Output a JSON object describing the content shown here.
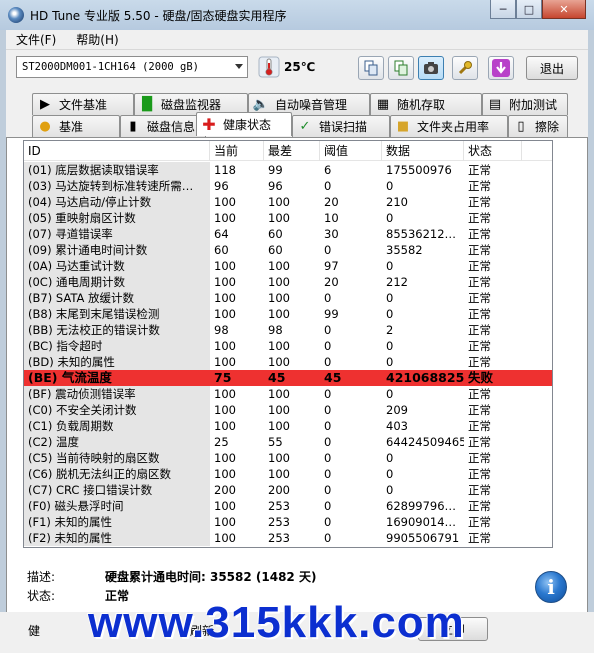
{
  "window": {
    "title": "HD Tune 专业版 5.50 - 硬盘/固态硬盘实用程序"
  },
  "menu": [
    {
      "label": "文件(F)"
    },
    {
      "label": "帮助(H)"
    }
  ],
  "toolbar": {
    "drive": "ST2000DM001-1CH164 (2000 gB)",
    "temperature": "25℃",
    "exit_label": "退出"
  },
  "tabs_row1": [
    {
      "label": "文件基准",
      "icon": "file-benchmark-icon"
    },
    {
      "label": "磁盘监视器",
      "icon": "disk-monitor-icon"
    },
    {
      "label": "自动噪音管理",
      "icon": "speaker-icon"
    },
    {
      "label": "随机存取",
      "icon": "random-access-icon"
    },
    {
      "label": "附加测试",
      "icon": "extra-tests-icon"
    }
  ],
  "tabs_row2": [
    {
      "label": "基准",
      "icon": "benchmark-icon"
    },
    {
      "label": "磁盘信息",
      "icon": "disk-info-icon"
    },
    {
      "label": "健康状态",
      "icon": "health-icon"
    },
    {
      "label": "错误扫描",
      "icon": "error-scan-icon"
    },
    {
      "label": "文件夹占用率",
      "icon": "folder-usage-icon"
    },
    {
      "label": "擦除",
      "icon": "erase-icon"
    }
  ],
  "table": {
    "headers": [
      "ID",
      "当前",
      "最差",
      "阈值",
      "数据",
      "状态"
    ],
    "rows": [
      [
        "(01) 底层数据读取错误率",
        "118",
        "99",
        "6",
        "175500976",
        "正常"
      ],
      [
        "(03) 马达旋转到标准转速所需…",
        "96",
        "96",
        "0",
        "0",
        "正常"
      ],
      [
        "(04) 马达启动/停止计数",
        "100",
        "100",
        "20",
        "210",
        "正常"
      ],
      [
        "(05) 重映射扇区计数",
        "100",
        "100",
        "10",
        "0",
        "正常"
      ],
      [
        "(07) 寻道错误率",
        "64",
        "60",
        "30",
        "85536212…",
        "正常"
      ],
      [
        "(09) 累计通电时间计数",
        "60",
        "60",
        "0",
        "35582",
        "正常"
      ],
      [
        "(0A) 马达重试计数",
        "100",
        "100",
        "97",
        "0",
        "正常"
      ],
      [
        "(0C) 通电周期计数",
        "100",
        "100",
        "20",
        "212",
        "正常"
      ],
      [
        "(B7) SATA 放缓计数",
        "100",
        "100",
        "0",
        "0",
        "正常"
      ],
      [
        "(B8) 末尾到末尾错误检测",
        "100",
        "100",
        "99",
        "0",
        "正常"
      ],
      [
        "(BB) 无法校正的错误计数",
        "98",
        "98",
        "0",
        "2",
        "正常"
      ],
      [
        "(BC) 指令超时",
        "100",
        "100",
        "0",
        "0",
        "正常"
      ],
      [
        "(BD) 未知的属性",
        "100",
        "100",
        "0",
        "0",
        "正常"
      ],
      [
        "(BE) 气流温度",
        "75",
        "45",
        "45",
        "421068825",
        "失败"
      ],
      [
        "(BF) 震动侦测错误率",
        "100",
        "100",
        "0",
        "0",
        "正常"
      ],
      [
        "(C0) 不安全关闭计数",
        "100",
        "100",
        "0",
        "209",
        "正常"
      ],
      [
        "(C1) 负载周期数",
        "100",
        "100",
        "0",
        "403",
        "正常"
      ],
      [
        "(C2) 温度",
        "25",
        "55",
        "0",
        "64424509465",
        "正常"
      ],
      [
        "(C5) 当前待映射的扇区数",
        "100",
        "100",
        "0",
        "0",
        "正常"
      ],
      [
        "(C6) 脱机无法纠正的扇区数",
        "100",
        "100",
        "0",
        "0",
        "正常"
      ],
      [
        "(C7) CRC 接口错误计数",
        "200",
        "200",
        "0",
        "0",
        "正常"
      ],
      [
        "(F0) 磁头悬浮时间",
        "100",
        "253",
        "0",
        "62899796…",
        "正常"
      ],
      [
        "(F1) 未知的属性",
        "100",
        "253",
        "0",
        "16909014…",
        "正常"
      ],
      [
        "(F2) 未知的属性",
        "100",
        "253",
        "0",
        "9905506791",
        "正常"
      ]
    ],
    "warn_row_index": 13,
    "warn_color": "#ee3130"
  },
  "details": {
    "desc_label": "描述:",
    "desc_value": "硬盘累计通电时间: 35582 (1482 天)",
    "status_label": "状态:",
    "status_value": "正常"
  },
  "bottom": {
    "health_label": "健",
    "refresh_label": "刷新",
    "update_label": "立即",
    "watermark": "www.315kkk.com"
  }
}
